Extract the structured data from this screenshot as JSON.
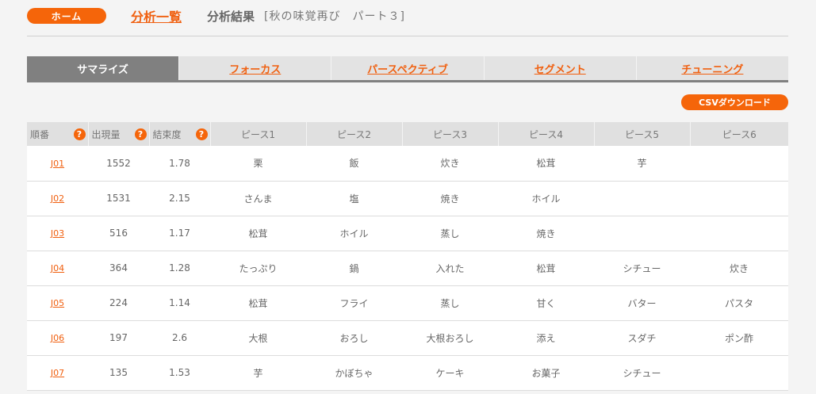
{
  "header": {
    "home_label": "ホーム",
    "nav_link": "分析一覧",
    "page_title": "分析結果",
    "page_subtitle": "[秋の味覚再び　パート３]"
  },
  "tabs": [
    {
      "label": "サマライズ",
      "active": true
    },
    {
      "label": "フォーカス",
      "active": false
    },
    {
      "label": "パースペクティブ",
      "active": false
    },
    {
      "label": "セグメント",
      "active": false
    },
    {
      "label": "チューニング",
      "active": false
    }
  ],
  "csv_button": "CSVダウンロード",
  "help_icon": "question-icon",
  "table": {
    "headers": [
      "順番",
      "出現量",
      "結束度",
      "ピース1",
      "ピース2",
      "ピース3",
      "ピース4",
      "ピース5",
      "ピース6"
    ],
    "rows": [
      [
        "J01",
        "1552",
        "1.78",
        "栗",
        "飯",
        "炊き",
        "松茸",
        "芋",
        ""
      ],
      [
        "J02",
        "1531",
        "2.15",
        "さんま",
        "塩",
        "焼き",
        "ホイル",
        "",
        ""
      ],
      [
        "J03",
        "516",
        "1.17",
        "松茸",
        "ホイル",
        "蒸し",
        "焼き",
        "",
        ""
      ],
      [
        "J04",
        "364",
        "1.28",
        "たっぷり",
        "鍋",
        "入れた",
        "松茸",
        "シチュー",
        "炊き"
      ],
      [
        "J05",
        "224",
        "1.14",
        "松茸",
        "フライ",
        "蒸し",
        "甘く",
        "バター",
        "パスタ"
      ],
      [
        "J06",
        "197",
        "2.6",
        "大根",
        "おろし",
        "大根おろし",
        "添え",
        "スダチ",
        "ポン酢"
      ],
      [
        "J07",
        "135",
        "1.53",
        "芋",
        "かぼちゃ",
        "ケーキ",
        "お菓子",
        "シチュー",
        ""
      ]
    ]
  },
  "colors": {
    "accent": "#f5650a",
    "tab_active": "#808080",
    "tab_inactive": "#e3e3e3"
  }
}
